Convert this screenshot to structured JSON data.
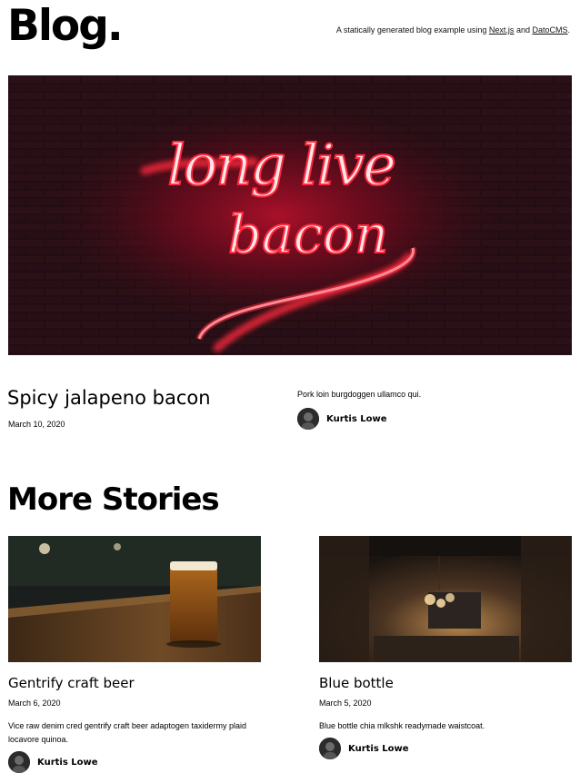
{
  "header": {
    "brand": "Blog.",
    "tagline_prefix": "A statically generated blog example using ",
    "link1": "Next.js",
    "tagline_middle": " and ",
    "link2": "DatoCMS",
    "tagline_suffix": "."
  },
  "hero": {
    "image_text_1": "long live",
    "image_text_2": "bacon",
    "title": "Spicy jalapeno bacon",
    "date": "March 10, 2020",
    "excerpt": "Pork loin burgdoggen ullamco qui.",
    "author": "Kurtis Lowe"
  },
  "more_stories": {
    "heading": "More Stories",
    "posts": [
      {
        "title": "Gentrify craft beer",
        "date": "March 6, 2020",
        "excerpt": "Vice raw denim cred gentrify craft beer adaptogen taxidermy plaid locavore quinoa.",
        "author": "Kurtis Lowe"
      },
      {
        "title": "Blue bottle",
        "date": "March 5, 2020",
        "excerpt": "Blue bottle chia mlkshk readymade waistcoat.",
        "author": "Kurtis Lowe"
      }
    ]
  },
  "colors": {
    "neon": "#ff2a3d",
    "brick_dark": "#1e0d12"
  }
}
